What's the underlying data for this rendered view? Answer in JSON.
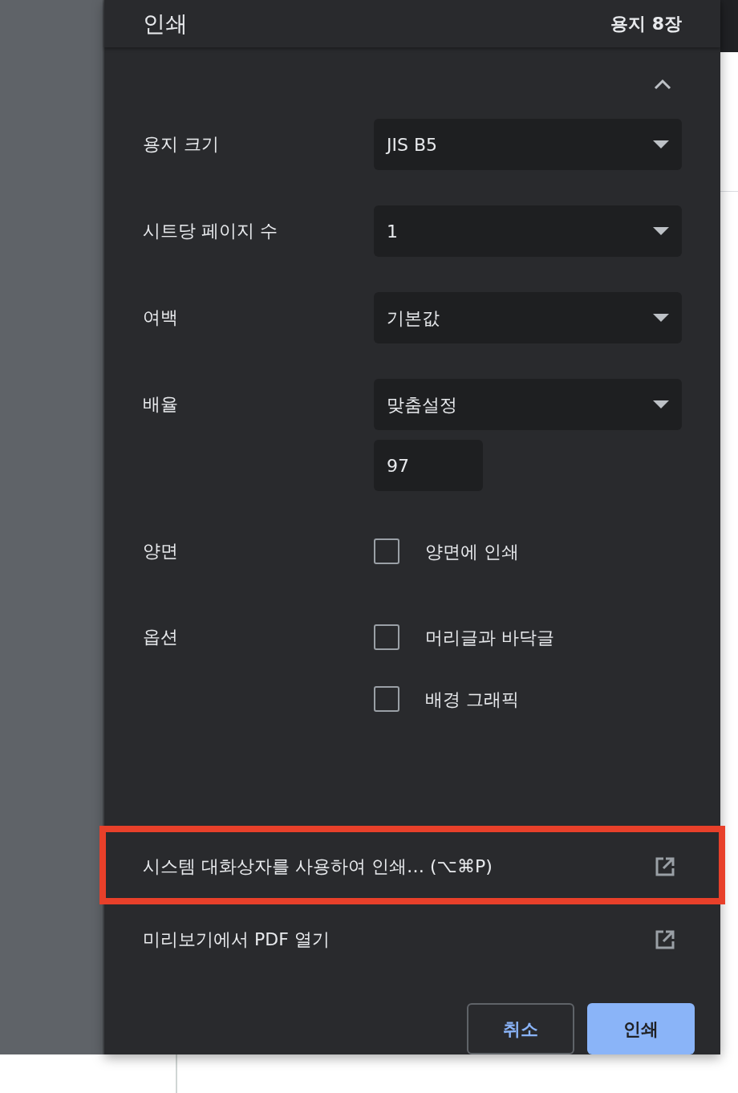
{
  "dialog": {
    "title": "인쇄",
    "sheet_count": "용지 8장"
  },
  "settings": [
    {
      "kind": "select",
      "label": "용지 크기",
      "value": "JIS B5"
    },
    {
      "kind": "select",
      "label": "시트당 페이지 수",
      "value": "1"
    },
    {
      "kind": "select",
      "label": "여백",
      "value": "기본값"
    },
    {
      "kind": "select_with_input",
      "label": "배율",
      "value": "맞춤설정",
      "input": "97"
    },
    {
      "kind": "checkboxes",
      "label": "양면",
      "options": [
        {
          "label": "양면에 인쇄",
          "checked": false
        }
      ]
    },
    {
      "kind": "checkboxes",
      "label": "옵션",
      "options": [
        {
          "label": "머리글과 바닥글",
          "checked": false
        },
        {
          "label": "배경 그래픽",
          "checked": false
        }
      ]
    }
  ],
  "links": [
    {
      "label": "시스템 대화상자를 사용하여 인쇄… (⌥⌘P)",
      "highlighted": true
    },
    {
      "label": "미리보기에서 PDF 열기",
      "highlighted": false
    }
  ],
  "buttons": [
    {
      "label": "취소",
      "kind": "secondary"
    },
    {
      "label": "인쇄",
      "kind": "primary"
    }
  ]
}
